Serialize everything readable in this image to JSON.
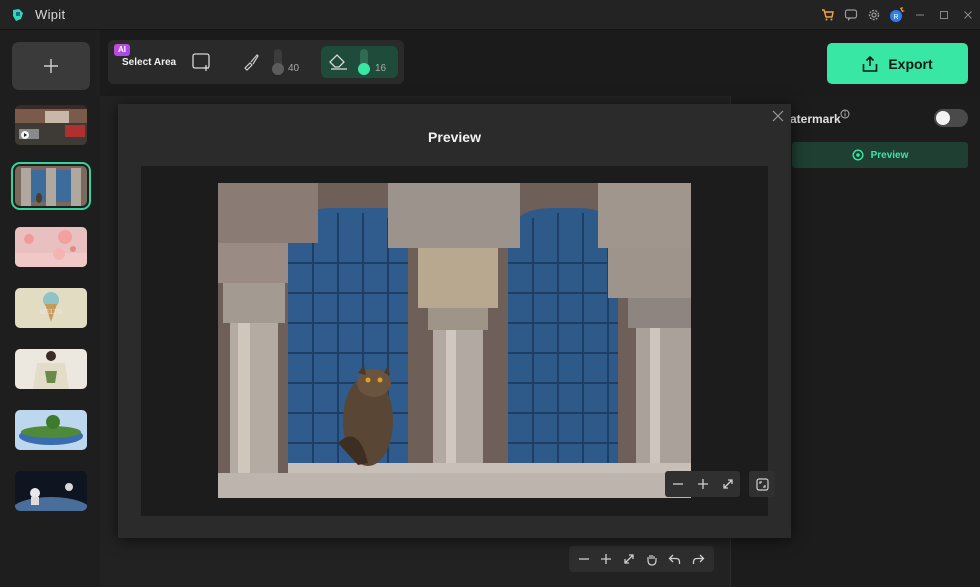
{
  "app": {
    "title": "Wipit"
  },
  "toolbar": {
    "ai_badge": "AI",
    "select_area_label": "Select Area",
    "brush_size": "40",
    "eraser_size": "16"
  },
  "export": {
    "label": "Export"
  },
  "right_panel": {
    "watermark_label": "atermark",
    "watermark_enabled": false,
    "preview_label": "Preview"
  },
  "modal": {
    "title": "Preview"
  },
  "colors": {
    "accent": "#39e7a5",
    "accent_dark": "#1f4b3a"
  },
  "thumbnails": [
    "street-scene",
    "owl-window",
    "balloons",
    "ice-cream",
    "person-shirt",
    "floating-island",
    "astronaut"
  ],
  "active_thumbnail": 1
}
